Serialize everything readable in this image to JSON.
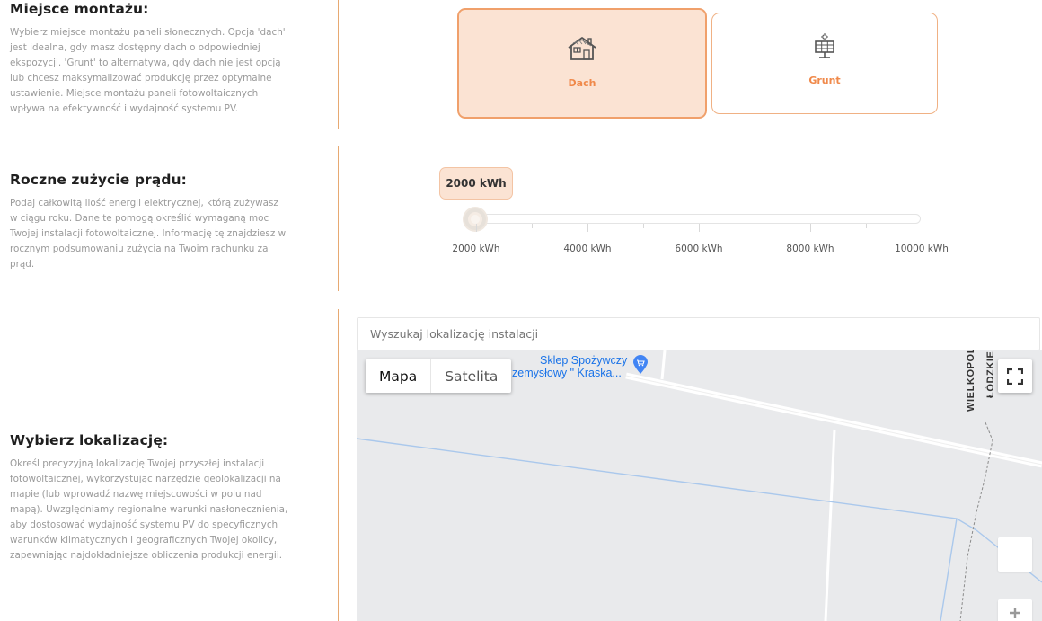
{
  "mounting": {
    "title": "Miejsce montażu:",
    "description": "Wybierz miejsce montażu paneli słonecznych. Opcja 'dach' jest idealna, gdy masz dostępny dach o odpowiedniej ekspozycji. 'Grunt' to alternatywa, gdy dach nie jest opcją lub chcesz maksymalizować produkcję przez optymalne ustawienie. Miejsce montażu paneli fotowoltaicznych wpływa na efektywność i wydajność systemu PV.",
    "options": [
      {
        "label": "Dach",
        "icon": "house-icon",
        "selected": true
      },
      {
        "label": "Grunt",
        "icon": "solar-panel-icon",
        "selected": false
      }
    ]
  },
  "consumption": {
    "title": "Roczne zużycie prądu:",
    "description": "Podaj całkowitą ilość energii elektrycznej, którą zużywasz w ciągu roku. Dane te pomogą określić wymaganą moc Twojej instalacji fotowoltaicznej. Informację tę znajdziesz w rocznym podsumowaniu zużycia na Twoim rachunku za prąd.",
    "slider": {
      "value_label": "2000 kWh",
      "value": 2000,
      "min": 2000,
      "max": 10000,
      "tick_labels": [
        "2000 kWh",
        "4000 kWh",
        "6000 kWh",
        "8000 kWh",
        "10000 kWh"
      ]
    }
  },
  "location": {
    "title": "Wybierz lokalizację:",
    "description": "Określ precyzyjną lokalizację Twojej przyszłej instalacji fotowoltaicznej, wykorzystując narzędzie geolokalizacji na mapie (lub wprowadź nazwę miejscowości w polu nad mapą). Uwzględniamy regionalne warunki nasłonecznienia, aby dostosować wydajność systemu PV do specyficznych warunków klimatycznych i geograficznych Twojej okolicy, zapewniając najdokładniejsze obliczenia produkcji energii.",
    "search_placeholder": "Wyszukaj lokalizację instalacji",
    "map": {
      "type_buttons": [
        "Mapa",
        "Satelita"
      ],
      "poi_line1": "Sklep Spożywczy",
      "poi_line2": "zemysłowy \" Kraska...",
      "region_label_1": "WIELKOPOL",
      "region_label_2": "ŁÓDZKIE",
      "road_color": "#ffffff",
      "water_color": "#aac8ec",
      "land_color": "#e9eaec"
    }
  },
  "colors": {
    "accent": "#f0894a",
    "accent_light": "#fbe3d3",
    "divider": "#e7a972"
  }
}
